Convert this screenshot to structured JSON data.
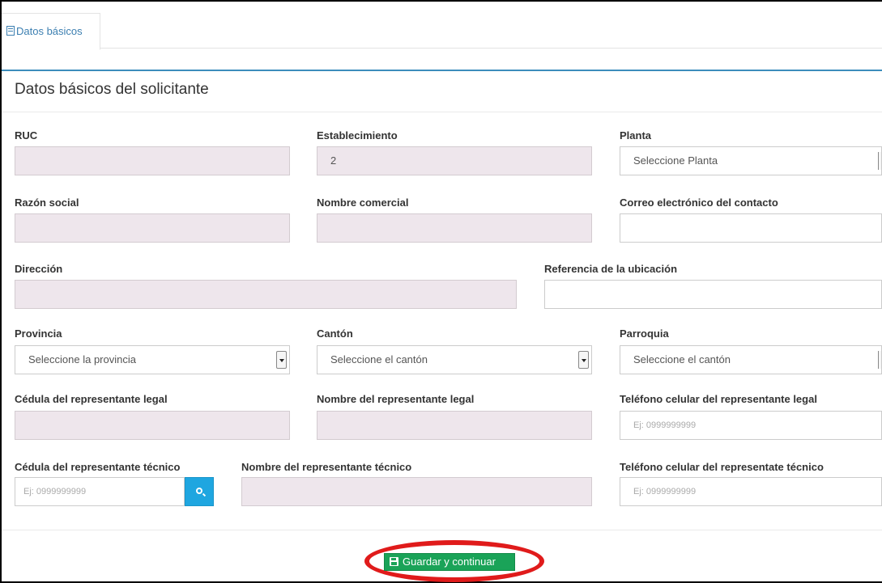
{
  "tabs": [
    {
      "label": "Datos básicos",
      "icon": "form-icon",
      "active": true
    }
  ],
  "panel": {
    "title": "Datos básicos del solicitante"
  },
  "fields": {
    "ruc": {
      "label": "RUC",
      "value": ""
    },
    "establecimiento": {
      "label": "Establecimiento",
      "value": "2"
    },
    "planta": {
      "label": "Planta",
      "value": "Seleccione Planta"
    },
    "razon_social": {
      "label": "Razón social",
      "value": ""
    },
    "nombre_comercial": {
      "label": "Nombre comercial",
      "value": ""
    },
    "correo": {
      "label": "Correo electrónico del contacto",
      "value": ""
    },
    "direccion": {
      "label": "Dirección",
      "value": ""
    },
    "referencia": {
      "label": "Referencia de la ubicación",
      "value": ""
    },
    "provincia": {
      "label": "Provincia",
      "value": "Seleccione la provincia"
    },
    "canton": {
      "label": "Cantón",
      "value": "Seleccione el cantón"
    },
    "parroquia": {
      "label": "Parroquia",
      "value": "Seleccione el cantón"
    },
    "cedula_legal": {
      "label": "Cédula del representante legal",
      "value": ""
    },
    "nombre_legal": {
      "label": "Nombre del representante legal",
      "value": ""
    },
    "telefono_legal": {
      "label": "Teléfono celular del representante legal",
      "placeholder": "Ej: 0999999999"
    },
    "cedula_tecnico": {
      "label": "Cédula del representante técnico",
      "placeholder": "Ej: 0999999999"
    },
    "nombre_tecnico": {
      "label": "Nombre del representante técnico",
      "value": ""
    },
    "telefono_tecnico": {
      "label": "Teléfono celular del representate técnico",
      "placeholder": "Ej: 0999999999"
    }
  },
  "actions": {
    "save_label": "Guardar y continuar",
    "save_icon": "save-icon",
    "search_icon": "search-icon"
  },
  "colors": {
    "accent": "#3c8dbc",
    "save_button": "#1aa358",
    "search_button": "#1fa6e0",
    "highlight": "#e01b1b",
    "disabled_field": "#eee6ec"
  }
}
